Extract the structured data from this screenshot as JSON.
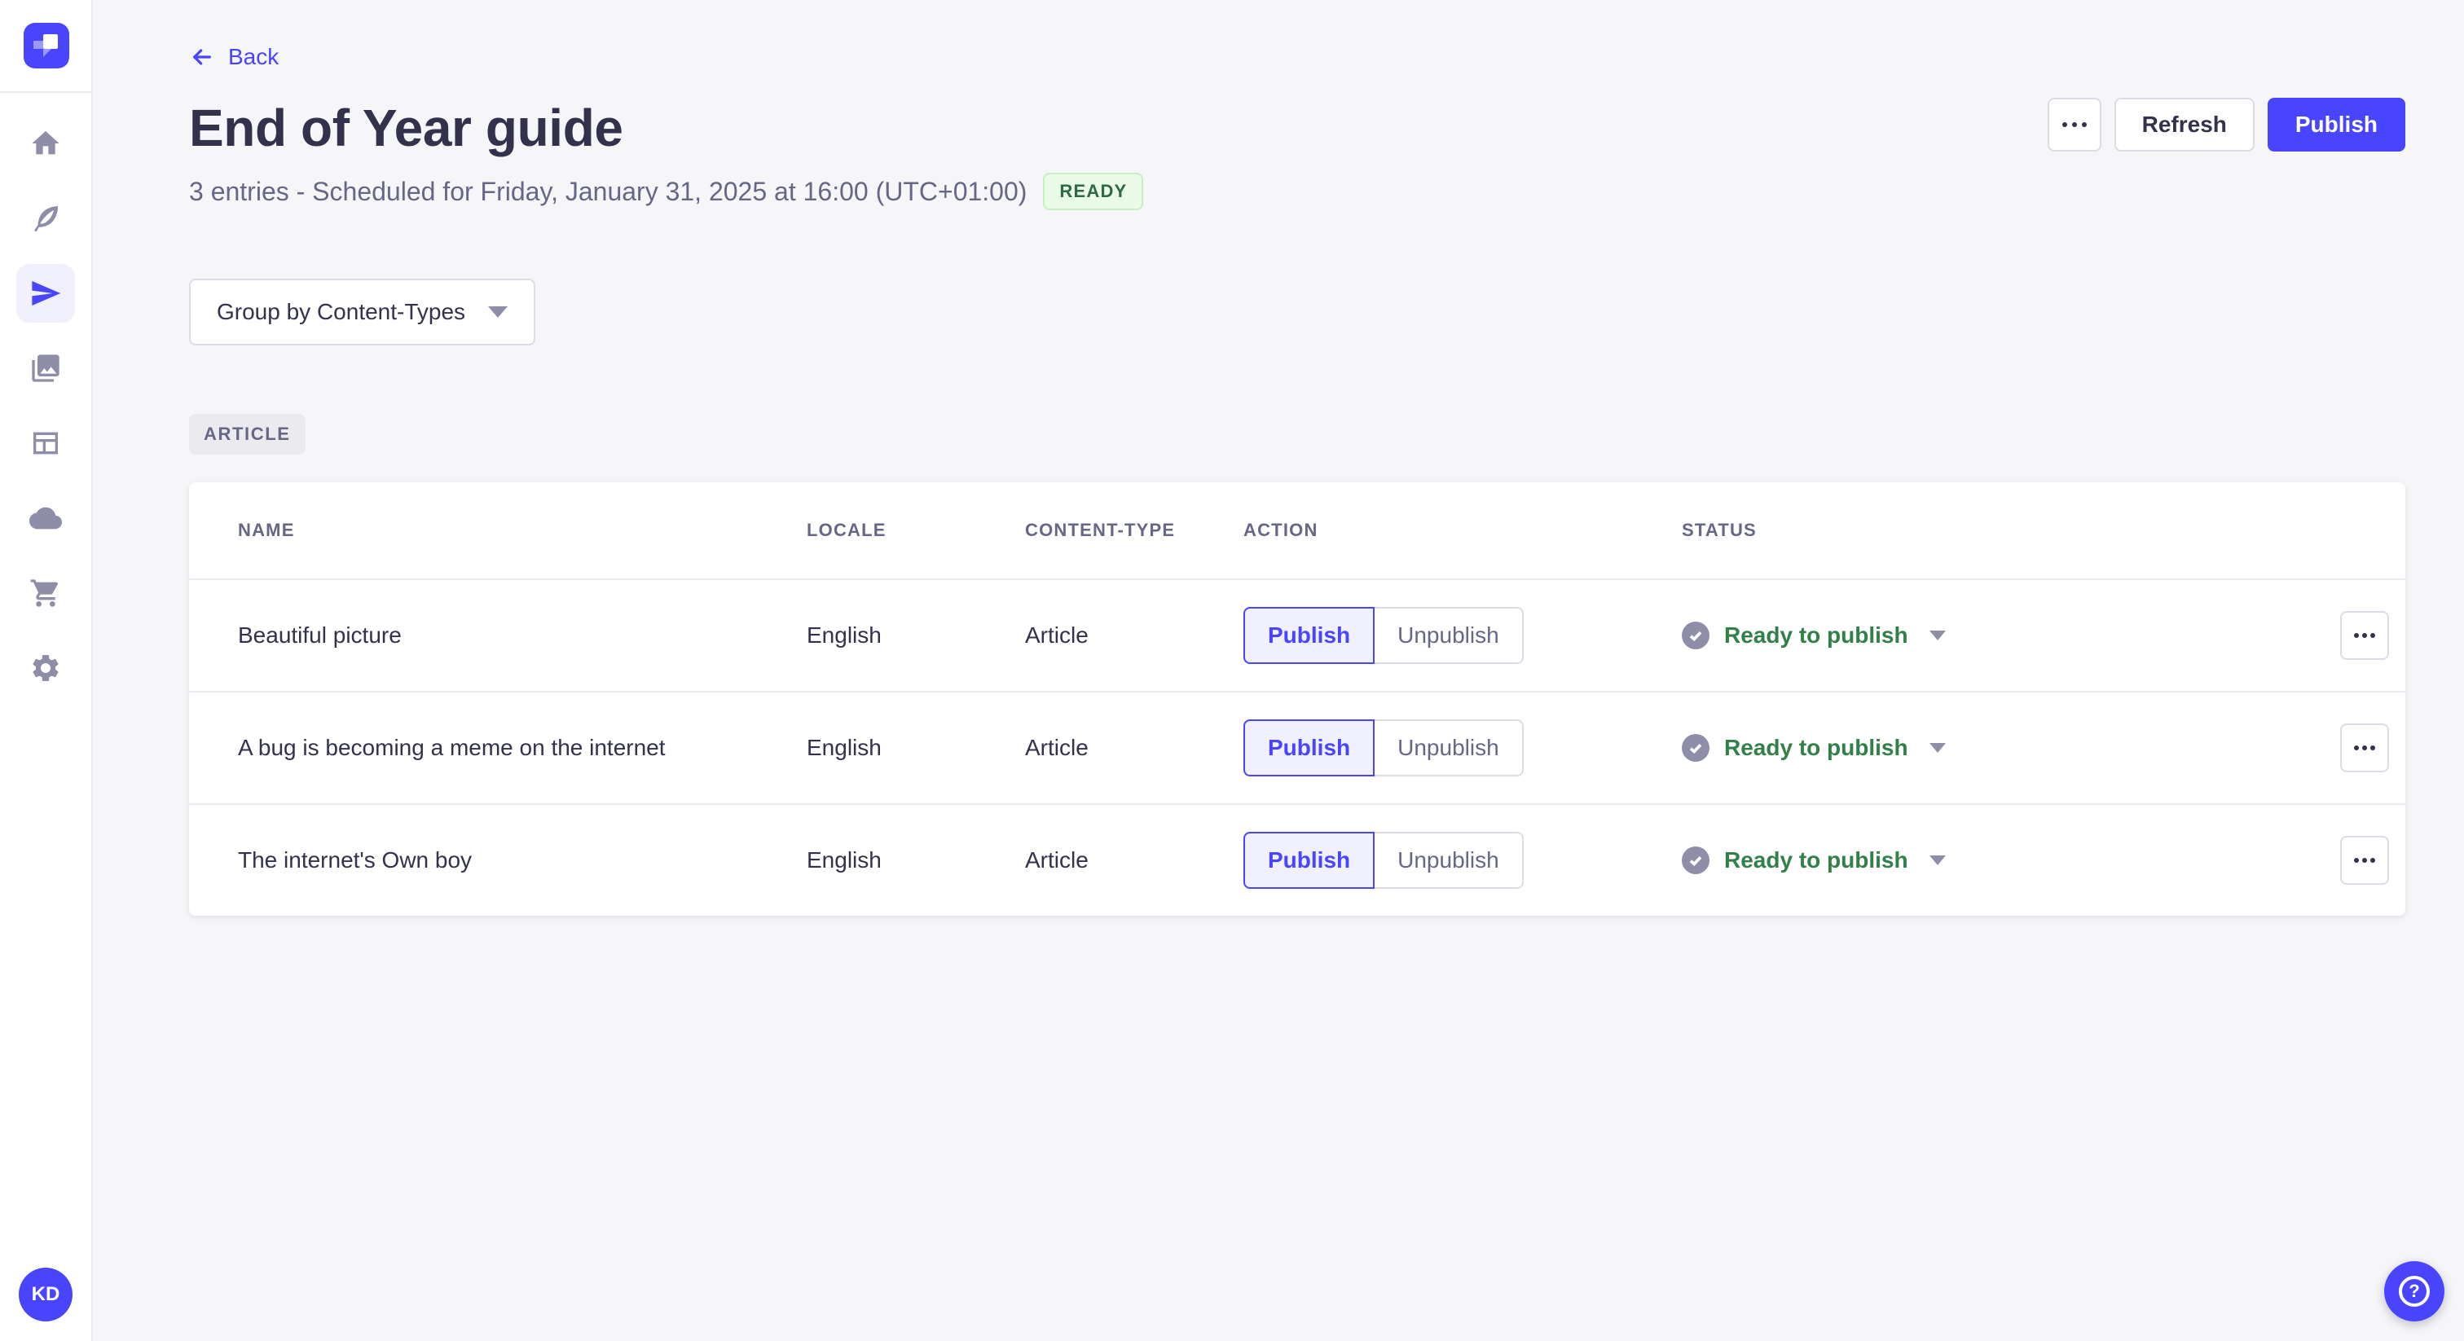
{
  "colors": {
    "accent": "#4945ff",
    "accent_light": "#f0f0ff",
    "success_text": "#328048",
    "ready_badge_bg": "#eafbe7",
    "ready_badge_border": "#c6f0c2",
    "ready_badge_text": "#2f6846",
    "neutral_icon": "#8e8ea9",
    "text_primary": "#32324d",
    "text_secondary": "#666687",
    "page_bg": "#f6f6f9",
    "border": "#dcdce4"
  },
  "sidebar": {
    "items": [
      {
        "name": "home"
      },
      {
        "name": "content-manager"
      },
      {
        "name": "releases",
        "active": true
      },
      {
        "name": "media-library"
      },
      {
        "name": "content-type-builder"
      },
      {
        "name": "deploy"
      },
      {
        "name": "marketplace"
      },
      {
        "name": "settings"
      }
    ],
    "avatar_initials": "KD"
  },
  "header": {
    "back_label": "Back",
    "title": "End of Year guide",
    "subtitle": "3 entries - Scheduled for Friday, January 31, 2025 at 16:00 (UTC+01:00)",
    "status_badge": "READY",
    "refresh_label": "Refresh",
    "publish_label": "Publish"
  },
  "toolbar": {
    "group_by_label": "Group by Content-Types"
  },
  "group": {
    "badge": "ARTICLE"
  },
  "table": {
    "headers": [
      "NAME",
      "LOCALE",
      "CONTENT-TYPE",
      "ACTION",
      "STATUS"
    ],
    "rows": [
      {
        "name": "Beautiful picture",
        "locale": "English",
        "content_type": "Article",
        "publish_label": "Publish",
        "unpublish_label": "Unpublish",
        "status": "Ready to publish"
      },
      {
        "name": "A bug is becoming a meme on the internet",
        "locale": "English",
        "content_type": "Article",
        "publish_label": "Publish",
        "unpublish_label": "Unpublish",
        "status": "Ready to publish"
      },
      {
        "name": "The internet's Own boy",
        "locale": "English",
        "content_type": "Article",
        "publish_label": "Publish",
        "unpublish_label": "Unpublish",
        "status": "Ready to publish"
      }
    ]
  },
  "help": {
    "icon": "?"
  }
}
